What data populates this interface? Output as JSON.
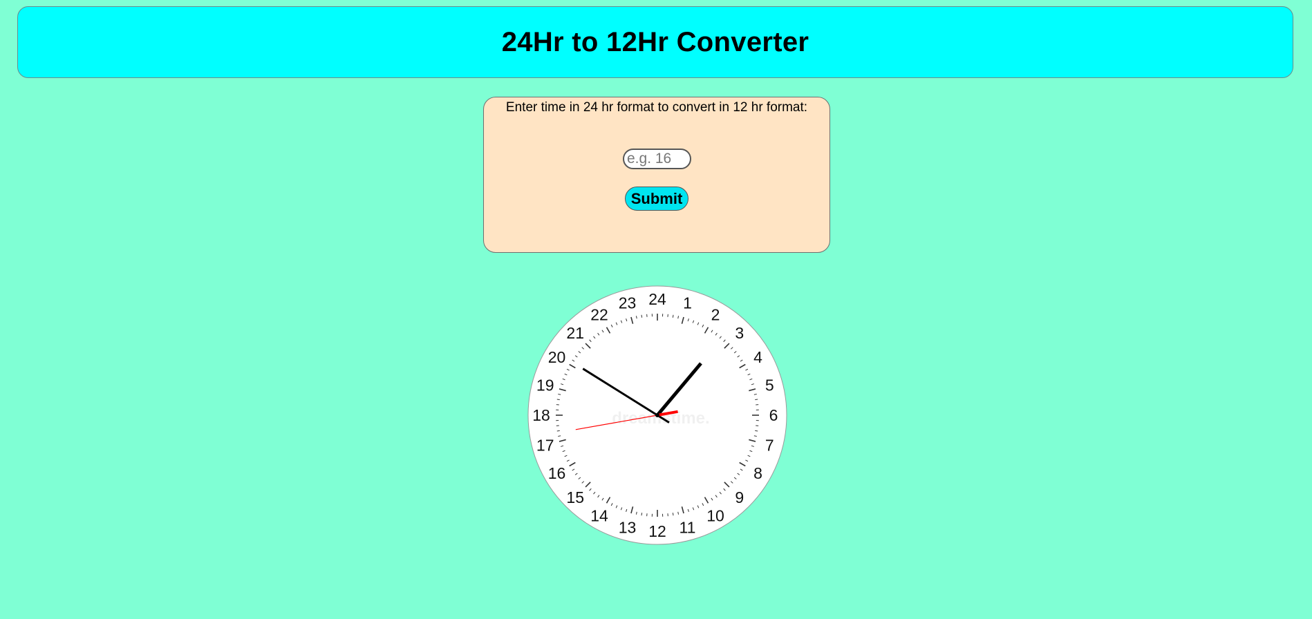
{
  "header": {
    "title": "24Hr to 12Hr Converter"
  },
  "converter": {
    "prompt": "Enter time in 24 hr format to convert in 12 hr format:",
    "input_placeholder": "e.g. 16",
    "input_value": "",
    "submit_label": "Submit"
  },
  "clock": {
    "hour_numbers": [
      "24",
      "1",
      "2",
      "3",
      "4",
      "5",
      "6",
      "7",
      "8",
      "9",
      "10",
      "11",
      "12",
      "13",
      "14",
      "15",
      "16",
      "17",
      "18",
      "19",
      "20",
      "21",
      "22",
      "23"
    ],
    "watermark": "dreamstime.",
    "colors": {
      "face": "#ffffff",
      "hands": "#000000",
      "second_hand": "#ff0000"
    }
  },
  "colors": {
    "page_background": "#7fffd4",
    "header_background": "#00ffff",
    "panel_background": "#ffe4c4",
    "button_background": "#00e5f0"
  }
}
